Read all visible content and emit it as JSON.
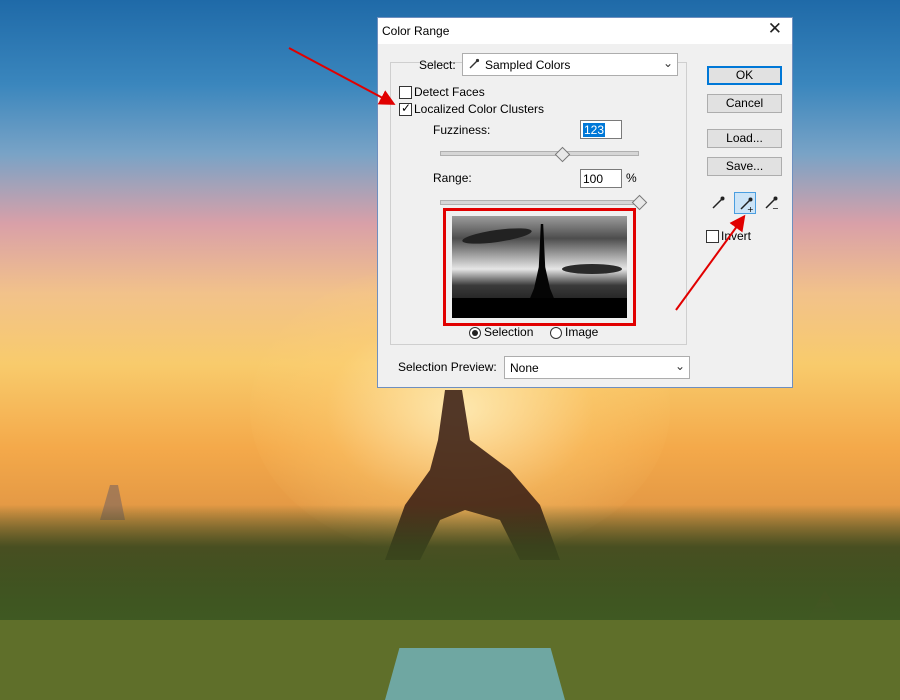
{
  "dialog": {
    "title": "Color Range",
    "select_label": "Select:",
    "select_value": "Sampled Colors",
    "detect_faces_label": "Detect Faces",
    "detect_faces_checked": false,
    "localized_clusters_label": "Localized Color Clusters",
    "localized_clusters_checked": true,
    "fuzziness_label": "Fuzziness:",
    "fuzziness_value": "123",
    "range_label": "Range:",
    "range_value": "100",
    "range_unit": "%",
    "view_options": {
      "selection": "Selection",
      "image": "Image",
      "selected": "Selection"
    },
    "selection_preview_label": "Selection Preview:",
    "selection_preview_value": "None",
    "buttons": {
      "ok": "OK",
      "cancel": "Cancel",
      "load": "Load...",
      "save": "Save..."
    },
    "invert_label": "Invert",
    "invert_checked": false,
    "eyedroppers": [
      "eyedropper-icon",
      "eyedropper-plus-icon",
      "eyedropper-minus-icon"
    ],
    "active_eyedropper": "eyedropper-plus-icon"
  },
  "annotations": {
    "arrow_color": "#e10000",
    "highlight_color": "#e10000"
  }
}
